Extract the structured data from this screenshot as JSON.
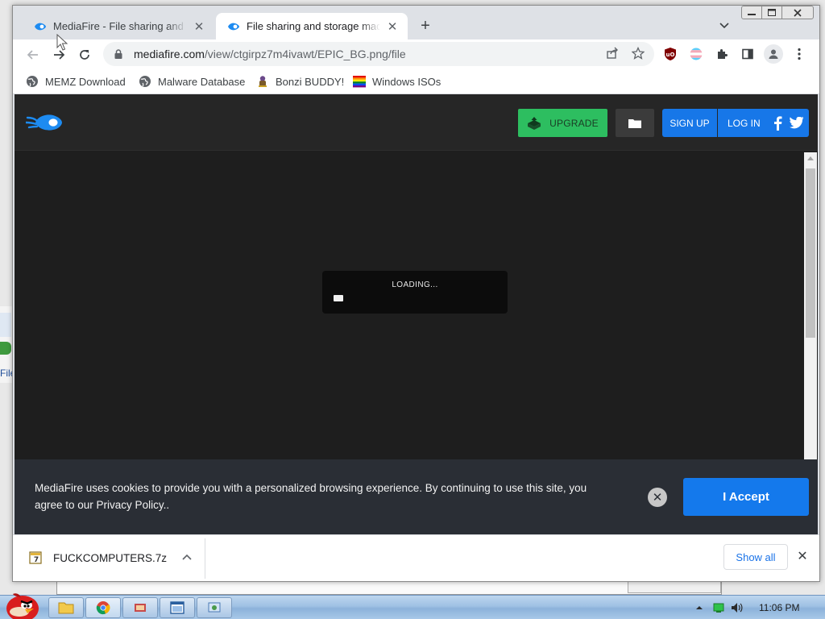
{
  "desktop": {
    "behind_window_label": "File"
  },
  "browser": {
    "tabs": [
      {
        "title": "MediaFire - File sharing and storage made simple",
        "active": false
      },
      {
        "title": "File sharing and storage made simple",
        "active": true
      }
    ],
    "url_host": "mediafire.com",
    "url_path": "/view/ctgirpz7m4ivawt/EPIC_BG.png/file",
    "bookmarks": [
      {
        "label": "MEMZ Download",
        "icon": "globe-icon"
      },
      {
        "label": "Malware Database",
        "icon": "globe-icon"
      },
      {
        "label": "Bonzi BUDDY!",
        "icon": "bonzi-icon"
      },
      {
        "label": "Windows ISOs",
        "icon": "rainbow-flag-icon"
      }
    ]
  },
  "mediafire": {
    "upgrade_label": "UPGRADE",
    "signup_label": "SIGN UP",
    "login_label": "LOG IN",
    "loading_text": "LOADING...",
    "loading_progress": 0.06,
    "cookie_message": "MediaFire uses cookies to provide you with a personalized browsing experience. By continuing to use this site, you agree to our Privacy Policy..",
    "accept_label": "I Accept"
  },
  "downloads": {
    "file_name": "FUCKCOMPUTERS.7z",
    "show_all_label": "Show all"
  },
  "taskbar": {
    "clock": "11:06 PM"
  },
  "colors": {
    "upgrade_green": "#2dbe60",
    "mf_blue": "#1777e8",
    "page_bg": "#1e1e1e",
    "cookie_bg": "#2a2e35"
  }
}
